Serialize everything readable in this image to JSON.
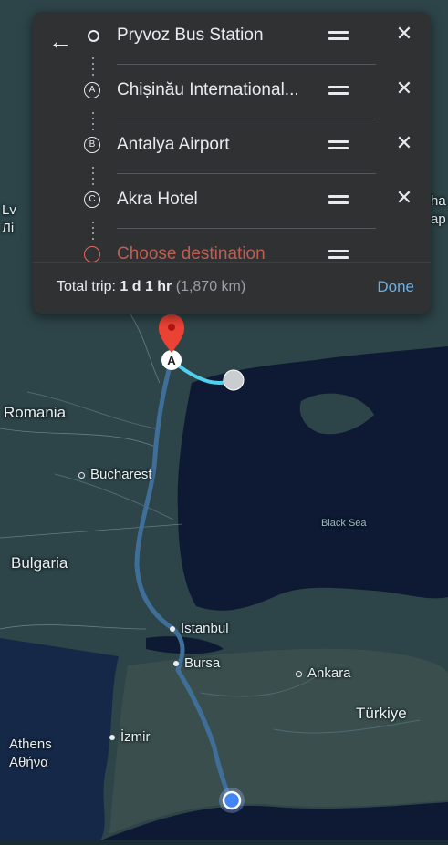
{
  "directions_panel": {
    "stops": [
      {
        "label": "Pryvoz Bus Station",
        "marker": "",
        "kind": "origin"
      },
      {
        "label": "Chișinău International...",
        "marker": "A",
        "kind": "waypoint"
      },
      {
        "label": "Antalya Airport",
        "marker": "B",
        "kind": "waypoint"
      },
      {
        "label": "Akra Hotel",
        "marker": "C",
        "kind": "waypoint"
      },
      {
        "label": "Choose destination",
        "marker": "",
        "kind": "destination"
      }
    ],
    "total_label": "Total trip:",
    "total_time": "1 d 1 hr",
    "total_distance": "(1,870 km)",
    "done_label": "Done"
  },
  "map": {
    "labels": {
      "romania": "Romania",
      "bucharest": "Bucharest",
      "bulgaria": "Bulgaria",
      "black_sea": "Black Sea",
      "istanbul": "Istanbul",
      "bursa": "Bursa",
      "ankara": "Ankara",
      "turkiye": "Türkiye",
      "athens": "Athens",
      "athens_greek": "Αθήνα",
      "izmir": "İzmir",
      "left_edge_1": "Lv",
      "left_edge_2": "Лі",
      "right_edge_1": "ha",
      "right_edge_2": "ap"
    },
    "colors": {
      "land": "#2d4448",
      "sea": "#0e1a33",
      "route": "#3f6f99",
      "route_active": "#4fd2f0",
      "pin": "#ea4335"
    }
  }
}
